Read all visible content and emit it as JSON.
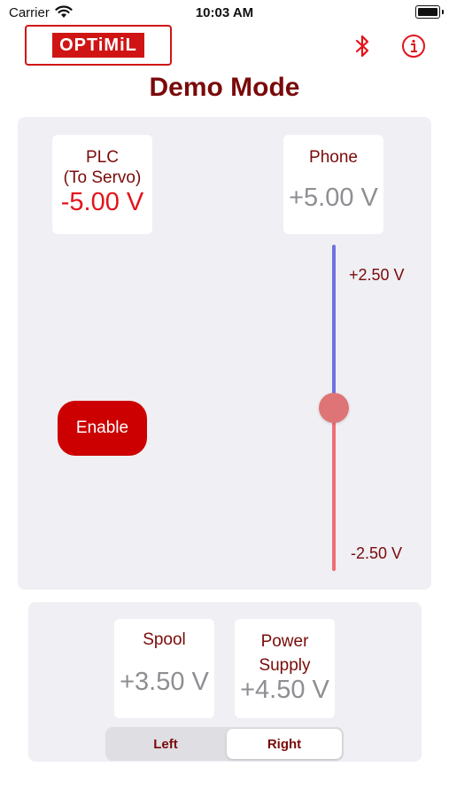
{
  "status_bar": {
    "carrier": "Carrier",
    "time": "10:03 AM"
  },
  "header": {
    "logo_text": "OPTiMiL",
    "title": "Demo Mode",
    "bluetooth_icon": "bluetooth-icon",
    "info_icon": "info-icon"
  },
  "plc": {
    "label_line1": "PLC",
    "label_line2": "(To Servo)",
    "value": "-5.00 V"
  },
  "phone": {
    "label": "Phone",
    "value": "+5.00 V"
  },
  "slider": {
    "max_label": "+2.50 V",
    "min_label": "-2.50 V",
    "position_fraction": 0.5
  },
  "enable_button": {
    "label": "Enable"
  },
  "spool": {
    "label": "Spool",
    "value": "+3.50 V"
  },
  "power_supply": {
    "label_line1": "Power",
    "label_line2": "Supply",
    "value": "+4.50 V"
  },
  "segment": {
    "options": [
      "Left",
      "Right"
    ],
    "selected": "Right"
  },
  "colors": {
    "brand_red": "#d01414",
    "title_dark_red": "#7a0a0a",
    "value_red": "#e3131b",
    "slider_upper": "#7072e0",
    "slider_lower": "#ee6f75",
    "button_red": "#cc0000"
  }
}
